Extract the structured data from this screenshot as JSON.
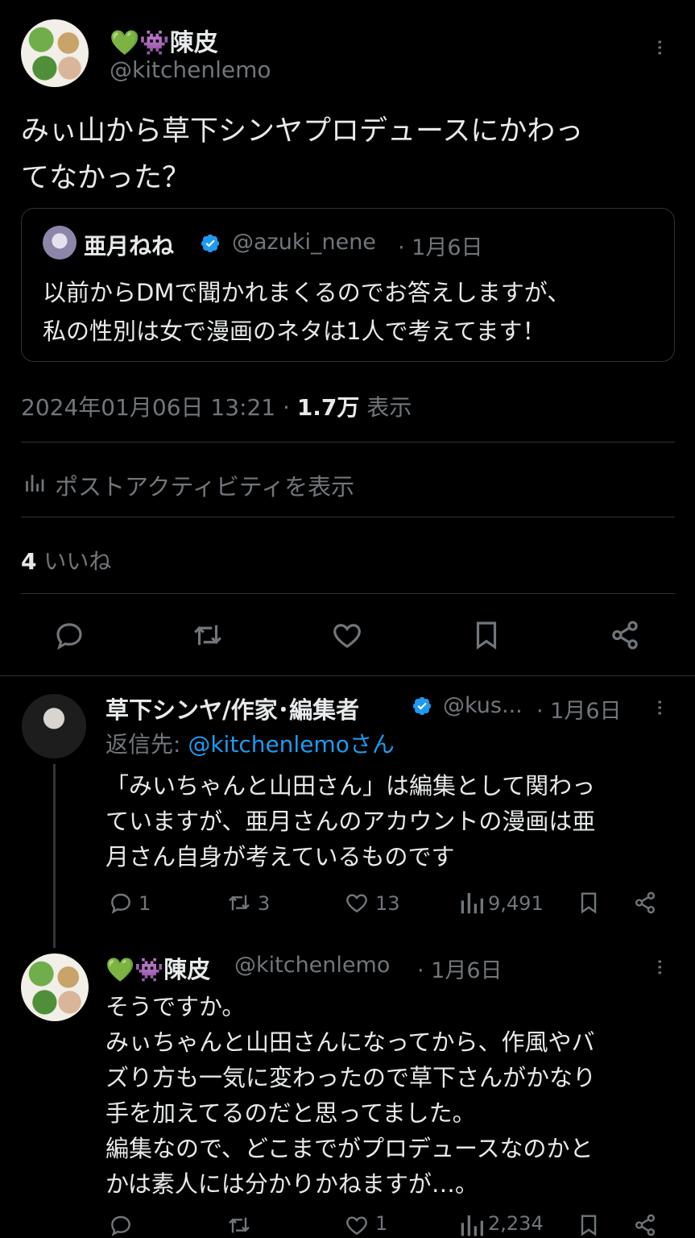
{
  "main_post": {
    "author": {
      "name": "💚👾陳皮",
      "handle": "@kitchenlemo"
    },
    "text_line1": "みぃ山から草下シンヤプロデュースにかわっ",
    "text_line2": "てなかった？",
    "quote": {
      "author_name": "亜月ねね",
      "handle": "@azuki_nene",
      "date": "· 1月6日",
      "text_line1": "以前からDMで聞かれまくるのでお答えしますが、",
      "text_line2": "私の性別は女で漫画のネタは1人で考えてます！"
    },
    "timestamp": "2024年01月06日 13:21 · ",
    "views_count": "1.7万",
    "views_label": " 表示",
    "activity_label": "ポストアクティビティを表示",
    "likes_count": "4",
    "likes_label": " いいね"
  },
  "reply1": {
    "author_name": "草下シンヤ/作家･編集者",
    "handle": "@kus...",
    "date": "· 1月6日",
    "reply_to_prefix": "返信先: ",
    "reply_to_handle": "@kitchenlemoさん",
    "text_line1": "「みいちゃんと山田さん」は編集として関わっ",
    "text_line2": "ていますが、亜月さんのアカウントの漫画は亜",
    "text_line3": "月さん自身が考えているものです",
    "replies": "1",
    "retweets": "3",
    "likes": "13",
    "views": "9,491"
  },
  "reply2": {
    "author_name": "💚👾陳皮",
    "handle": "@kitchenlemo",
    "date": "· 1月6日",
    "text_line1": "そうですか。",
    "text_line2": "みぃちゃんと山田さんになってから、作風やバ",
    "text_line3": "ズり方も一気に変わったので草下さんがかなり",
    "text_line4": "手を加えてるのだと思ってました。",
    "text_line5": "編集なので、どこまでがプロデュースなのかと",
    "text_line6": "かは素人には分かりかねますが…。",
    "likes": "1",
    "views": "2,234"
  },
  "colors": {
    "background": "#000000",
    "text": "#e7e9ea",
    "muted": "#71767b",
    "accent": "#1d9bf0",
    "divider": "#2f3336"
  },
  "icons": [
    "more-icon",
    "verified-icon",
    "reply-icon",
    "retweet-icon",
    "like-icon",
    "bookmark-icon",
    "share-icon",
    "views-icon"
  ]
}
